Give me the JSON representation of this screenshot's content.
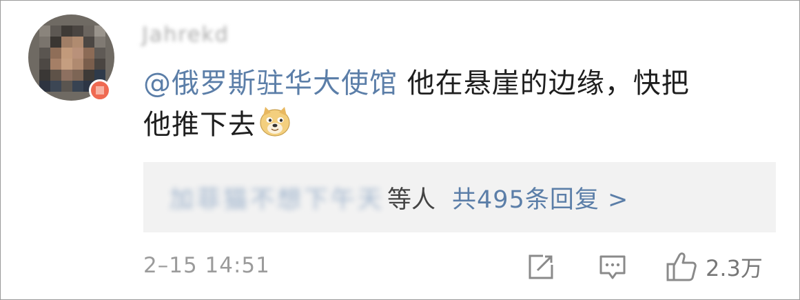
{
  "comment": {
    "author": "Jahrekd",
    "mention": "@俄罗斯驻华大使馆",
    "body_line1": " 他在悬崖的边缘，快把",
    "body_line2": "他推下去",
    "emoji_icon": "doge-emoji-icon"
  },
  "replies": {
    "names": "加菲猫不想下午天",
    "suffix": "等人",
    "count_label": "共495条回复 >"
  },
  "footer": {
    "timestamp": "2–15 14:51",
    "like_count": "2.3万"
  },
  "colors": {
    "link": "#5b7ea8",
    "reply_bg": "#f2f2f2",
    "meta": "#9b9b9b",
    "verified_badge": "#ef6a52"
  }
}
